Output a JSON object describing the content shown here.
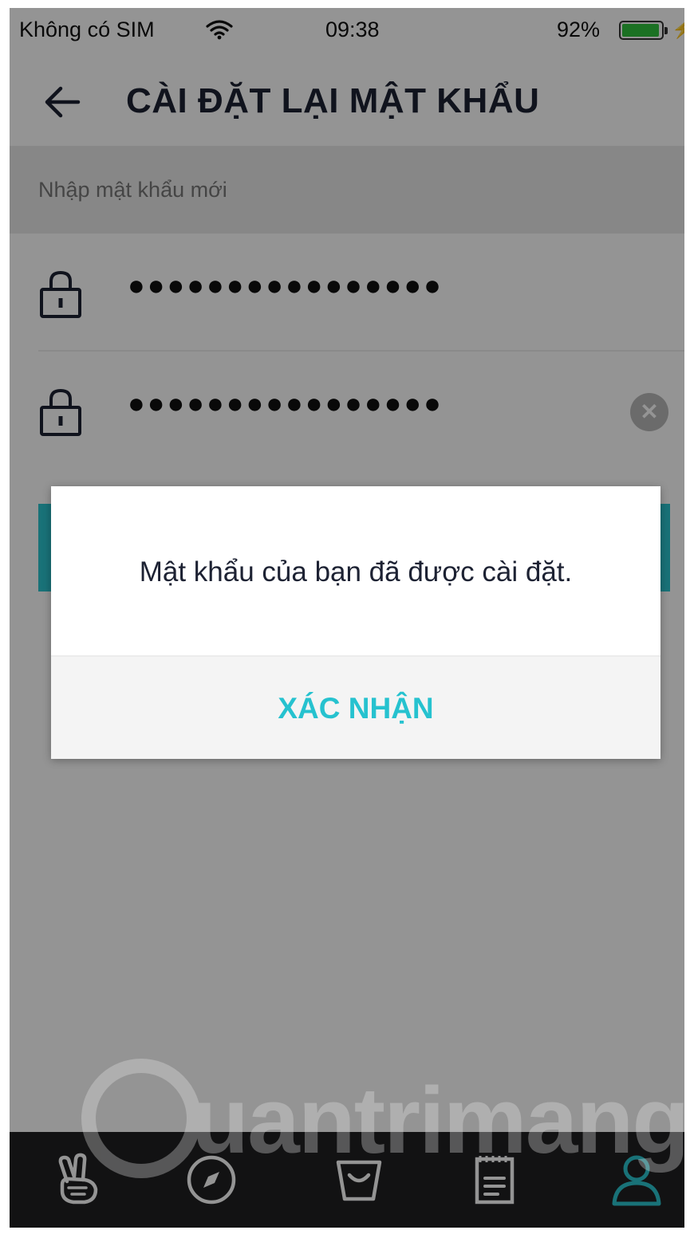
{
  "status_bar": {
    "carrier": "Không có SIM",
    "time": "09:38",
    "battery_percent": "92%",
    "battery_level": 0.92,
    "battery_color": "#2fc33d"
  },
  "header": {
    "title": "CÀI ĐẶT LẠI MẬT KHẨU",
    "back_icon": "arrow-left-icon"
  },
  "form": {
    "section_label": "Nhập mật khẩu mới",
    "password_1": "●●●●●●●●●●●●●●●●",
    "password_2": "●●●●●●●●●●●●●●●●",
    "lock_icon": "lock-icon",
    "clear_icon": "clear-icon",
    "clear_glyph": "✕"
  },
  "dialog": {
    "message": "Mật khẩu của bạn đã được cài đặt.",
    "confirm_label": "XÁC NHẬN",
    "accent_color": "#26c2cf"
  },
  "tabbar": {
    "tabs": [
      {
        "icon": "victory-hand-icon",
        "active": false
      },
      {
        "icon": "compass-icon",
        "active": false
      },
      {
        "icon": "shopping-bag-icon",
        "active": false
      },
      {
        "icon": "notebook-icon",
        "active": false
      },
      {
        "icon": "profile-icon",
        "active": true
      }
    ],
    "active_color": "#2bc4cf"
  },
  "watermark": "uantrimang"
}
